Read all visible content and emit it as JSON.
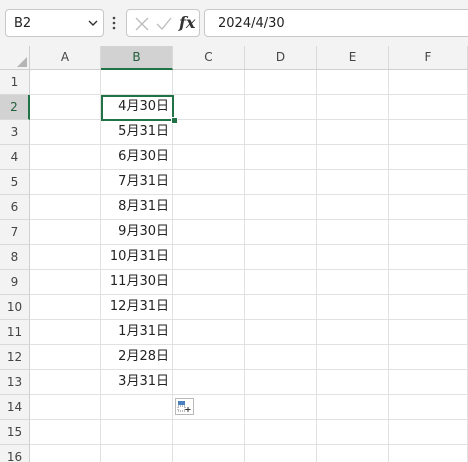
{
  "name_box": {
    "value": "B2"
  },
  "formula_bar": {
    "fx_label": "fx",
    "formula": "2024/4/30"
  },
  "columns": [
    "A",
    "B",
    "C",
    "D",
    "E",
    "F"
  ],
  "rows": [
    "1",
    "2",
    "3",
    "4",
    "5",
    "6",
    "7",
    "8",
    "9",
    "10",
    "11",
    "12",
    "13",
    "14",
    "15",
    "16"
  ],
  "column_b_values": [
    "",
    "4月30日",
    "5月31日",
    "6月30日",
    "7月31日",
    "8月31日",
    "9月30日",
    "10月31日",
    "11月30日",
    "12月31日",
    "1月31日",
    "2月28日",
    "3月31日",
    "",
    "",
    ""
  ],
  "selection": {
    "column": "B",
    "row": "2"
  },
  "colors": {
    "accent": "#217346",
    "header_bg": "#f3f3f3",
    "selected_header_bg": "#d2d2d2",
    "gridline": "#e1e1e1"
  }
}
